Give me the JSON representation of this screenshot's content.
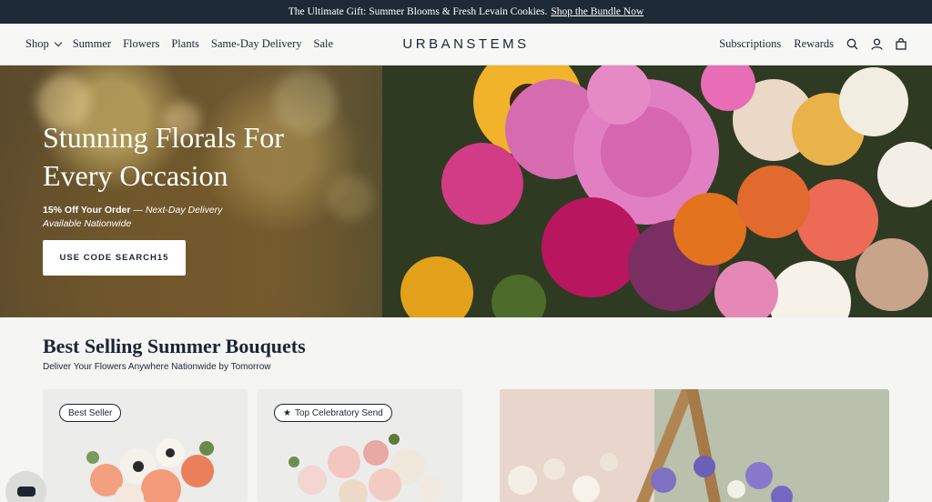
{
  "announcement": {
    "text": "The Ultimate Gift: Summer Blooms & Fresh Levain Cookies.",
    "link": "Shop the Bundle Now"
  },
  "nav": {
    "left": [
      "Shop",
      "Summer",
      "Flowers",
      "Plants",
      "Same-Day Delivery",
      "Sale"
    ],
    "logo": "URBANSTEMS",
    "right": [
      "Subscriptions",
      "Rewards"
    ],
    "icons": [
      "search-icon",
      "account-icon",
      "cart-icon"
    ]
  },
  "hero": {
    "title": "Stunning Florals For Every Occasion",
    "sub_bold": "15% Off Your Order",
    "sub_rest": "Next-Day Delivery Available Nationwide",
    "button": "USE CODE SEARCH15"
  },
  "bestsellers": {
    "title": "Best Selling Summer Bouquets",
    "subtitle": "Deliver Your Flowers Anywhere Nationwide by Tomorrow",
    "cards": [
      {
        "badge": "Best Seller"
      },
      {
        "badge": "Top Celebratory Send",
        "badge_icon": "star-icon"
      }
    ]
  },
  "colors": {
    "navy": "#1d2937",
    "background": "#f5f5f3"
  }
}
